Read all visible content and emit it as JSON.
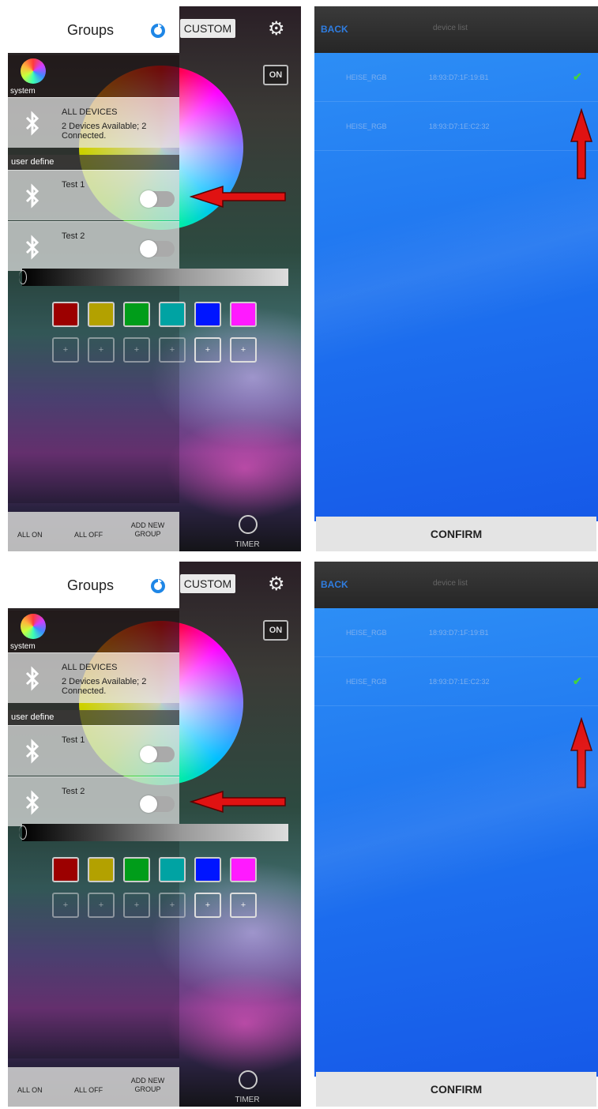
{
  "left_panel": {
    "title": "Groups",
    "custom_label": "CUSTOM",
    "on_label": "ON",
    "system_label": "system",
    "all_devices": {
      "title": "ALL DEVICES",
      "subtitle": "2 Devices Available; 2 Connected."
    },
    "user_define_label": "user define",
    "groups": [
      "Test 1",
      "Test 2"
    ],
    "swatch_colors": [
      "#9c0000",
      "#b3a100",
      "#009d1a",
      "#00a3a3",
      "#0015ff",
      "#ff1aff"
    ],
    "add_label": "+",
    "bottom": {
      "all_on": "ALL ON",
      "all_off": "ALL OFF",
      "add_group": "ADD NEW GROUP",
      "timer": "TIMER"
    }
  },
  "right_panel": {
    "back_label": "BACK",
    "title": "device list",
    "devices": [
      {
        "name": "HEISE_RGB",
        "mac": "18:93:D7:1F:19:B1"
      },
      {
        "name": "HEISE_RGB",
        "mac": "18:93:D7:1E:C2:32"
      }
    ],
    "confirm_label": "CONFIRM"
  },
  "screens": [
    {
      "selected_group": "Test 1",
      "checked_device": 0
    },
    {
      "selected_group": "Test 2",
      "checked_device": 1
    }
  ]
}
